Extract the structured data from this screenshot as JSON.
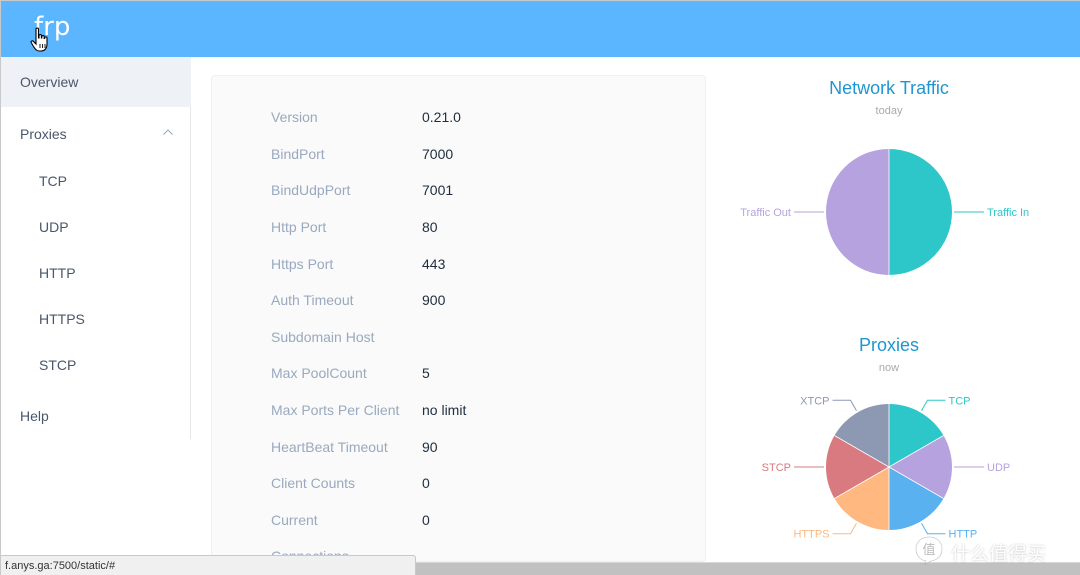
{
  "app": {
    "logo": "frp"
  },
  "sidebar": {
    "items": [
      {
        "label": "Overview"
      },
      {
        "label": "Proxies"
      },
      {
        "label": "TCP"
      },
      {
        "label": "UDP"
      },
      {
        "label": "HTTP"
      },
      {
        "label": "HTTPS"
      },
      {
        "label": "STCP"
      },
      {
        "label": "Help"
      }
    ]
  },
  "overview": {
    "rows": [
      {
        "key": "Version",
        "value": "0.21.0"
      },
      {
        "key": "BindPort",
        "value": "7000"
      },
      {
        "key": "BindUdpPort",
        "value": "7001"
      },
      {
        "key": "Http Port",
        "value": "80"
      },
      {
        "key": "Https Port",
        "value": "443"
      },
      {
        "key": "Auth Timeout",
        "value": "900"
      },
      {
        "key": "Subdomain Host",
        "value": ""
      },
      {
        "key": "Max PoolCount",
        "value": "5"
      },
      {
        "key": "Max Ports Per Client",
        "value": "no limit"
      },
      {
        "key": "HeartBeat Timeout",
        "value": "90"
      },
      {
        "key": "Client Counts",
        "value": "0"
      },
      {
        "key": "Current",
        "value": "0"
      },
      {
        "key": "Connections",
        "value": ""
      }
    ]
  },
  "chart_data": [
    {
      "type": "pie",
      "title": "Network Traffic",
      "subtitle": "today",
      "categories": [
        "Traffic In",
        "Traffic Out"
      ],
      "values": [
        50,
        50
      ],
      "colors": [
        "#2ec7c9",
        "#b6a2de"
      ]
    },
    {
      "type": "pie",
      "title": "Proxies",
      "subtitle": "now",
      "categories": [
        "TCP",
        "UDP",
        "HTTP",
        "HTTPS",
        "STCP",
        "XTCP"
      ],
      "values": [
        1,
        1,
        1,
        1,
        1,
        1
      ],
      "colors": [
        "#2ec7c9",
        "#b6a2de",
        "#5ab1ef",
        "#ffb980",
        "#d87a80",
        "#8d98b3"
      ]
    }
  ],
  "status_bar": {
    "url": "f.anys.ga:7500/static/#"
  },
  "watermark": {
    "text": "什么值得买"
  }
}
